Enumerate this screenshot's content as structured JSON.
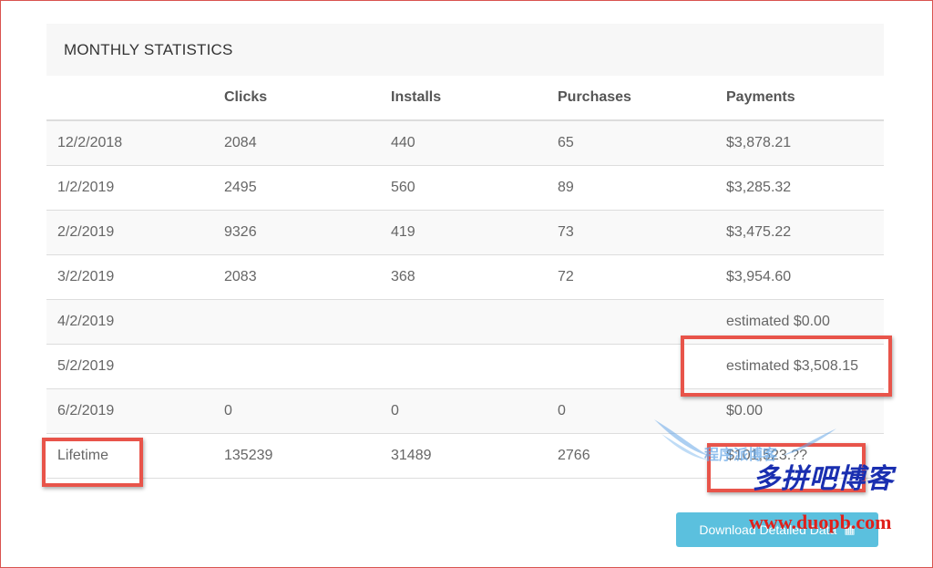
{
  "panel": {
    "title": "MONTHLY STATISTICS",
    "columns": [
      "",
      "Clicks",
      "Installs",
      "Purchases",
      "Payments"
    ],
    "rows": [
      {
        "date": "12/2/2018",
        "clicks": "2084",
        "installs": "440",
        "purchases": "65",
        "payments": "$3,878.21"
      },
      {
        "date": "1/2/2019",
        "clicks": "2495",
        "installs": "560",
        "purchases": "89",
        "payments": "$3,285.32"
      },
      {
        "date": "2/2/2019",
        "clicks": "9326",
        "installs": "419",
        "purchases": "73",
        "payments": "$3,475.22"
      },
      {
        "date": "3/2/2019",
        "clicks": "2083",
        "installs": "368",
        "purchases": "72",
        "payments": "$3,954.60"
      },
      {
        "date": "4/2/2019",
        "clicks": "",
        "installs": "",
        "purchases": "",
        "payments": "estimated $0.00"
      },
      {
        "date": "5/2/2019",
        "clicks": "",
        "installs": "",
        "purchases": "",
        "payments": "estimated $3,508.15"
      },
      {
        "date": "6/2/2019",
        "clicks": "0",
        "installs": "0",
        "purchases": "0",
        "payments": "$0.00"
      },
      {
        "date": "Lifetime",
        "clicks": "135239",
        "installs": "31489",
        "purchases": "2766",
        "payments": "$101,523.??"
      }
    ]
  },
  "download_button": {
    "label": "Download Detailed Data",
    "icon": "spreadsheet-icon"
  },
  "watermark": {
    "logo_text": "程序派博客",
    "cn_text": "多拼吧博客",
    "url_text": "www.duopb.com"
  },
  "colors": {
    "highlight": "#e8544a",
    "button": "#5bc0de",
    "header_bg": "#f7f7f7",
    "stripe": "#f9f9f9"
  }
}
